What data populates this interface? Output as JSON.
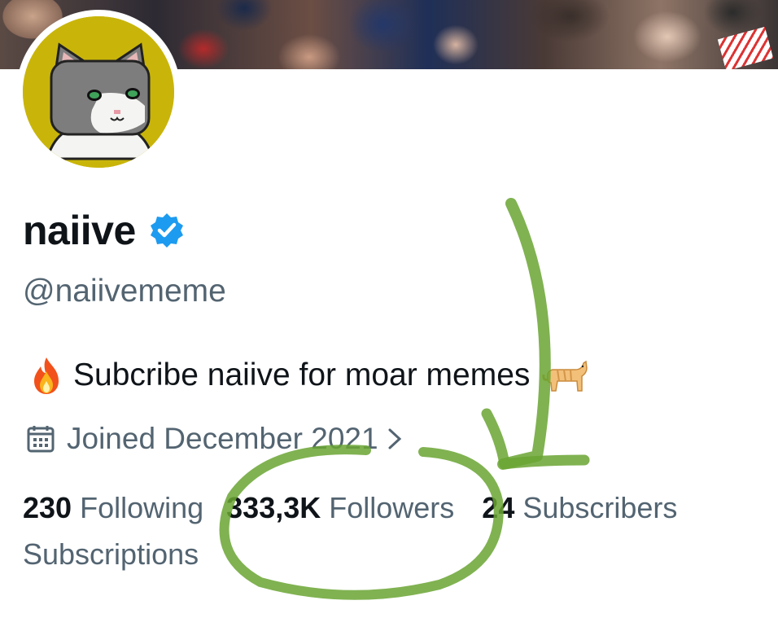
{
  "profile": {
    "display_name": "naiive",
    "handle": "@naiivememe",
    "verified_icon": "verified-badge-icon",
    "bio_text": "Subcribe naiive for moar memes",
    "bio_prefix_icon": "fire-emoji",
    "bio_suffix_icon": "cat-emoji",
    "joined_text": "Joined December 2021"
  },
  "stats": {
    "following_count": "230",
    "following_label": "Following",
    "followers_count": "333,3K",
    "followers_label": "Followers",
    "subscribers_count": "24",
    "subscribers_label": "Subscribers",
    "subscriptions_label": "Subscriptions"
  },
  "colors": {
    "verified_blue": "#1d9bf0",
    "secondary_text": "#536471",
    "annotation_green": "#6aa532",
    "avatar_bg": "#c9b50a"
  }
}
